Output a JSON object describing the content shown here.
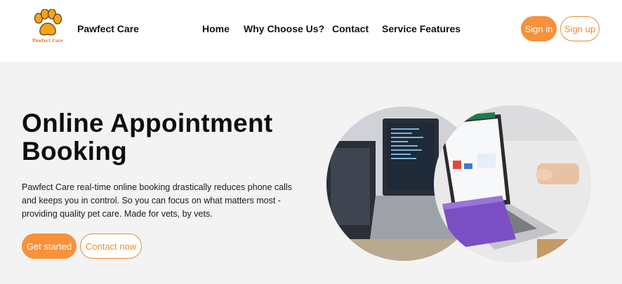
{
  "brand": {
    "logo_text": "Pawfect Care",
    "name": "Pawfect Care"
  },
  "nav": {
    "items": [
      {
        "label": "Home"
      },
      {
        "label": "Why Choose Us?"
      },
      {
        "label": "Contact"
      },
      {
        "label": "Service Features"
      }
    ]
  },
  "auth": {
    "sign_in": "Sign in",
    "sign_up": "Sign up"
  },
  "hero": {
    "title": "Online Appointment Booking",
    "description": "Pawfect Care real-time online booking drastically reduces phone calls and keeps you in control. So you can focus on what matters most - providing quality pet care. Made for vets, by vets.",
    "primary_cta": "Get started",
    "secondary_cta": "Contact now"
  },
  "colors": {
    "accent": "#f7913a",
    "hero_bg": "#f3f3f3"
  },
  "icons": {
    "logo": "paw-print-icon"
  }
}
